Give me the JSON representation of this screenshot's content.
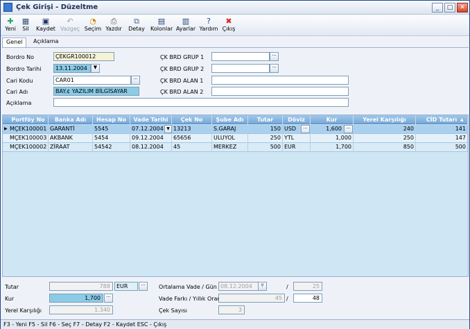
{
  "window": {
    "title": "Çek Girişi - Düzeltme"
  },
  "toolbar": {
    "yeni": "Yeni",
    "sil": "Sil",
    "kaydet": "Kaydet",
    "vazgec": "Vazgeç",
    "secim": "Seçim",
    "yazdir": "Yazdır",
    "detay": "Detay",
    "kolonlar": "Kolonlar",
    "ayarlar": "Ayarlar",
    "yardim": "Yardım",
    "cikis": "Çıkış"
  },
  "tabs": {
    "genel": "Genel",
    "aciklama": "Açıklama"
  },
  "form": {
    "bordro_no_label": "Bordro No",
    "bordro_no": "ÇEKGR100012",
    "bordro_tarihi_label": "Bordro Tarihi",
    "bordro_tarihi": "13.11.2004",
    "cari_kodu_label": "Cari Kodu",
    "cari_kodu": "CAR01",
    "cari_adi_label": "Cari Adı",
    "cari_adi": "BAY.¢ YAZILIM BİLGİSAYAR",
    "aciklama_label": "Açıklama",
    "ck_brd_grup1_label": "ÇK BRD GRUP 1",
    "ck_brd_grup2_label": "ÇK BRD GRUP 2",
    "ck_brd_alan1_label": "ÇK BRD ALAN 1",
    "ck_brd_alan2_label": "ÇK BRD ALAN 2",
    "ellipsis": "···"
  },
  "grid": {
    "headers": [
      "Portföy No",
      "Banka Adı",
      "Hesap No",
      "Vade Tarihi",
      "Çek No",
      "Şube Adı",
      "Tutar",
      "Döviz",
      "Kur",
      "Yerel Karşılığı",
      "CİD Tutarı"
    ],
    "rows": [
      [
        "MÇEK100001",
        "GARANTİ",
        "5545",
        "07.12.2004",
        "13213",
        "S.GARAJ",
        "150",
        "USD",
        "1,600",
        "240",
        "141"
      ],
      [
        "MÇEK100003",
        "AKBANK",
        "5454",
        "09.12.2004",
        "65656",
        "ULUYOL",
        "250",
        "YTL",
        "1,000",
        "250",
        "147"
      ],
      [
        "MÇEK100002",
        "ZİRAAT",
        "54542",
        "08.12.2004",
        "45",
        "MERKEZ",
        "500",
        "EUR",
        "1,700",
        "850",
        "500"
      ]
    ],
    "row_marker": "▶",
    "sort_arrow": "▲"
  },
  "summary": {
    "tutar_label": "Tutar",
    "tutar": "788",
    "doviz": "EUR",
    "kur_label": "Kur",
    "kur": "1,700",
    "yerel_label": "Yerel Karşılığı",
    "yerel": "1.340",
    "ort_vade_label": "Ortalama Vade / Gün",
    "ort_vade": "08.12.2004",
    "ort_gun": "25",
    "vade_farki_label": "Vade Farkı / Yıllık Oranı",
    "vade_farki": "45",
    "yillik_oran": "48",
    "cek_sayisi_label": "Çek Sayısı",
    "cek_sayisi": "3",
    "slash": "/"
  },
  "status_bar": "F3 - Yeni  F5 - Sil  F6 - Seç  F7 - Detay  F2 - Kaydet  ESC - Çıkış",
  "colors": {
    "title_bar": "#dde5f0",
    "grid_header": "#78a9d8",
    "grid_bg": "#cfe6f5",
    "selected_row": "#a9d0ef"
  }
}
